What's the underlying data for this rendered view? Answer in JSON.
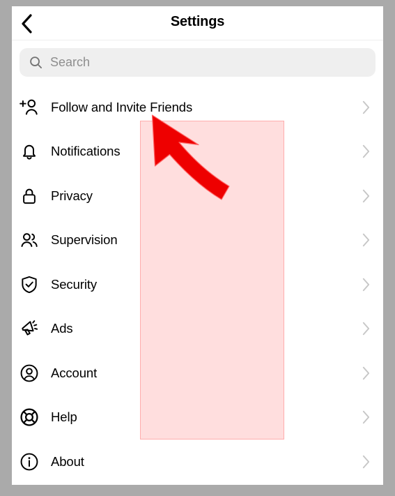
{
  "window": {
    "frame_color": "#aaaaaa",
    "screen_background": "#ffffff"
  },
  "header": {
    "title": "Settings",
    "back_icon": "chevron-left-icon"
  },
  "search": {
    "placeholder": "Search",
    "value": "",
    "icon": "search-icon",
    "background_color": "#efefef"
  },
  "settings": {
    "items": [
      {
        "label": "Follow and Invite Friends",
        "icon": "person-add-icon",
        "chevron": "chevron-right-icon"
      },
      {
        "label": "Notifications",
        "icon": "bell-icon",
        "chevron": "chevron-right-icon"
      },
      {
        "label": "Privacy",
        "icon": "lock-icon",
        "chevron": "chevron-right-icon"
      },
      {
        "label": "Supervision",
        "icon": "people-icon",
        "chevron": "chevron-right-icon"
      },
      {
        "label": "Security",
        "icon": "shield-check-icon",
        "chevron": "chevron-right-icon"
      },
      {
        "label": "Ads",
        "icon": "megaphone-icon",
        "chevron": "chevron-right-icon"
      },
      {
        "label": "Account",
        "icon": "account-circle-icon",
        "chevron": "chevron-right-icon"
      },
      {
        "label": "Help",
        "icon": "lifebuoy-icon",
        "chevron": "chevron-right-icon"
      },
      {
        "label": "About",
        "icon": "info-circle-icon",
        "chevron": "chevron-right-icon"
      }
    ]
  },
  "annotation": {
    "highlight_color": "#ffdddd",
    "arrow_color": "#ee0000",
    "arrow_name": "curved-pointer-arrow",
    "target_label": "Follow and Invite Friends"
  }
}
